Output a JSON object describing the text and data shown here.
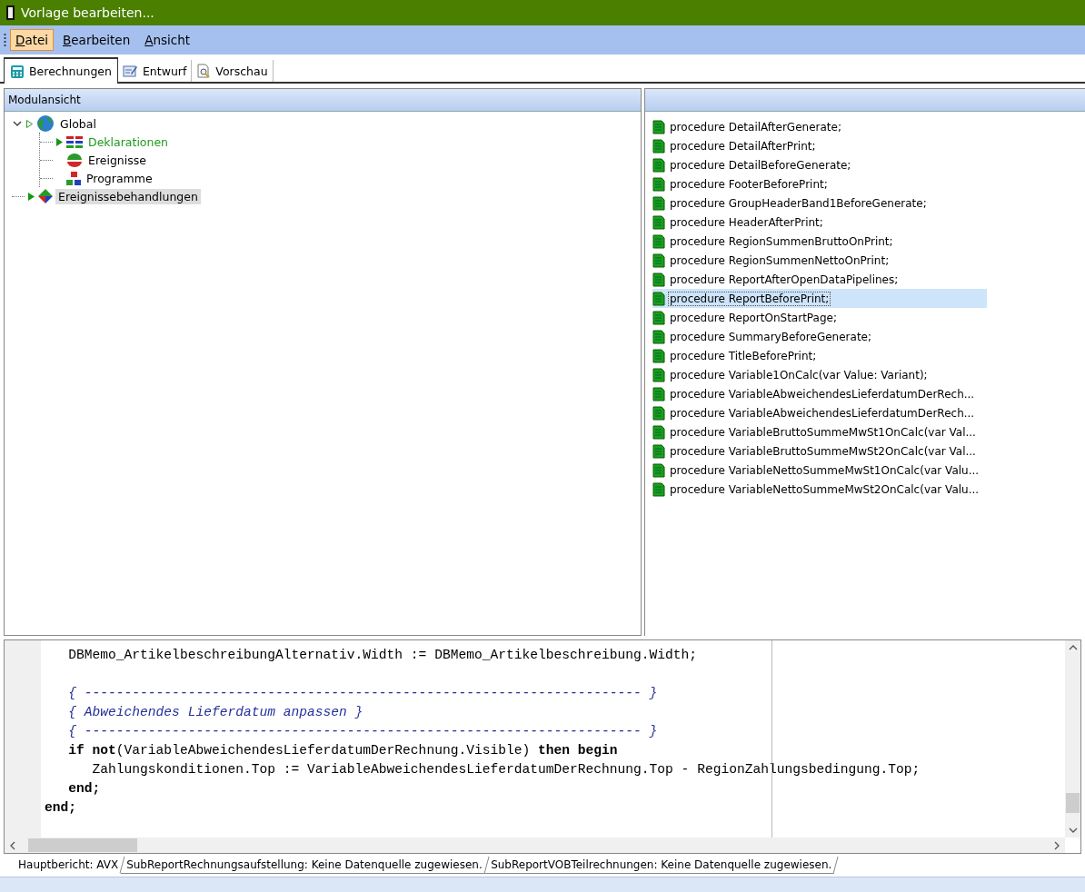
{
  "window": {
    "title": "Vorlage bearbeiten..."
  },
  "menu": [
    {
      "label": "Datei",
      "selected": true
    },
    {
      "label": "Bearbeiten",
      "selected": false
    },
    {
      "label": "Ansicht",
      "selected": false
    }
  ],
  "tabs": [
    {
      "label": "Berechnungen",
      "kind": "calc",
      "selected": true
    },
    {
      "label": "Entwurf",
      "kind": "design",
      "selected": false
    },
    {
      "label": "Vorschau",
      "kind": "preview",
      "selected": false
    }
  ],
  "module_view": {
    "title": "Modulansicht",
    "tree": [
      {
        "label": "Global",
        "kind": "globe",
        "marker": true,
        "marker_hollow": true,
        "active": false,
        "selected": false,
        "expanded": true,
        "children": [
          {
            "label": "Deklarationen",
            "kind": "grid",
            "marker": true,
            "marker_hollow": false,
            "active": true,
            "selected": false
          },
          {
            "label": "Ereignisse",
            "kind": "events",
            "marker": false,
            "active": false,
            "selected": false
          },
          {
            "label": "Programme",
            "kind": "blocks",
            "marker": false,
            "active": false,
            "selected": false
          }
        ]
      },
      {
        "label": "Ereignissebehandlungen",
        "kind": "diamond",
        "marker": true,
        "marker_hollow": false,
        "active": false,
        "selected": true
      }
    ]
  },
  "procedures": [
    {
      "label": "procedure DetailAfterGenerate;",
      "selected": false
    },
    {
      "label": "procedure DetailAfterPrint;",
      "selected": false
    },
    {
      "label": "procedure DetailBeforeGenerate;",
      "selected": false
    },
    {
      "label": "procedure FooterBeforePrint;",
      "selected": false
    },
    {
      "label": "procedure GroupHeaderBand1BeforeGenerate;",
      "selected": false
    },
    {
      "label": "procedure HeaderAfterPrint;",
      "selected": false
    },
    {
      "label": "procedure RegionSummenBruttoOnPrint;",
      "selected": false
    },
    {
      "label": "procedure RegionSummenNettoOnPrint;",
      "selected": false
    },
    {
      "label": "procedure ReportAfterOpenDataPipelines;",
      "selected": false
    },
    {
      "label": "procedure ReportBeforePrint;",
      "selected": true
    },
    {
      "label": "procedure ReportOnStartPage;",
      "selected": false
    },
    {
      "label": "procedure SummaryBeforeGenerate;",
      "selected": false
    },
    {
      "label": "procedure TitleBeforePrint;",
      "selected": false
    },
    {
      "label": "procedure Variable1OnCalc(var Value: Variant);",
      "selected": false
    },
    {
      "label": "procedure VariableAbweichendesLieferdatumDerRech...",
      "selected": false
    },
    {
      "label": "procedure VariableAbweichendesLieferdatumDerRech...",
      "selected": false
    },
    {
      "label": "procedure VariableBruttoSummeMwSt1OnCalc(var Val...",
      "selected": false
    },
    {
      "label": "procedure VariableBruttoSummeMwSt2OnCalc(var Val...",
      "selected": false
    },
    {
      "label": "procedure VariableNettoSummeMwSt1OnCalc(var Valu...",
      "selected": false
    },
    {
      "label": "procedure VariableNettoSummeMwSt2OnCalc(var Valu...",
      "selected": false
    }
  ],
  "code": [
    {
      "kind": "code",
      "segments": [
        {
          "text": "   DBMemo_ArtikelbeschreibungAlternativ.Width := DBMemo_Artikelbeschreibung.Width;",
          "kind": "plain"
        }
      ]
    },
    {
      "kind": "blank"
    },
    {
      "kind": "code",
      "segments": [
        {
          "text": "   { ---------------------------------------------------------------------- }",
          "kind": "comment"
        }
      ]
    },
    {
      "kind": "code",
      "segments": [
        {
          "text": "   { Abweichendes Lieferdatum anpassen }",
          "kind": "comment"
        }
      ]
    },
    {
      "kind": "code",
      "segments": [
        {
          "text": "   { ---------------------------------------------------------------------- }",
          "kind": "comment"
        }
      ]
    },
    {
      "kind": "code",
      "segments": [
        {
          "text": "   if not",
          "kind": "keyword"
        },
        {
          "text": "(VariableAbweichendesLieferdatumDerRechnung.Visible) ",
          "kind": "plain"
        },
        {
          "text": "then begin",
          "kind": "keyword"
        }
      ]
    },
    {
      "kind": "code",
      "segments": [
        {
          "text": "      Zahlungskonditionen.Top := VariableAbweichendesLieferdatumDerRechnung.Top - RegionZahlungsbedingung.Top;",
          "kind": "plain"
        }
      ]
    },
    {
      "kind": "code",
      "segments": [
        {
          "text": "   end;",
          "kind": "keyword"
        }
      ]
    },
    {
      "kind": "code",
      "segments": [
        {
          "text": "end;",
          "kind": "keyword"
        }
      ]
    }
  ],
  "report_tabs": [
    {
      "label": "Hauptbericht: AVX",
      "selected": true
    },
    {
      "label": "SubReportRechnungsaufstellung: Keine Datenquelle zugewiesen.",
      "selected": false
    },
    {
      "label": "SubReportVOBTeilrechnungen: Keine Datenquelle zugewiesen.",
      "selected": false
    }
  ]
}
